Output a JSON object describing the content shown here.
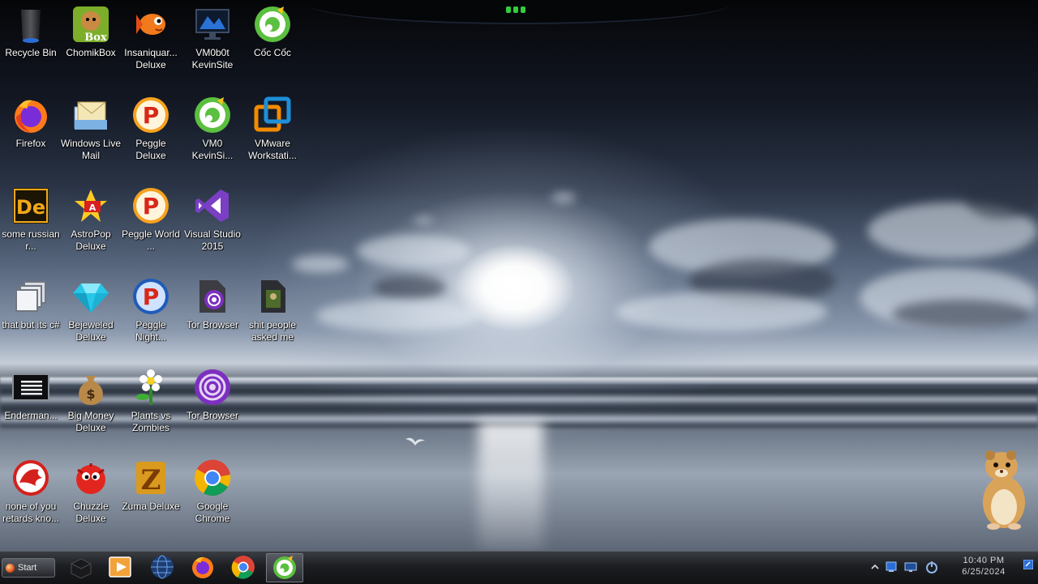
{
  "desktop": {
    "icons": [
      {
        "label": "Recycle Bin",
        "icon": "recycle-bin-icon"
      },
      {
        "label": "ChomikBox",
        "icon": "chomikbox-icon"
      },
      {
        "label": "Insaniquar... Deluxe",
        "icon": "goldfish-icon"
      },
      {
        "label": "VM0b0t KevinSite",
        "icon": "monitor-icon"
      },
      {
        "label": "Cốc Cốc",
        "icon": "coccoc-icon"
      },
      {
        "label": "Firefox",
        "icon": "firefox-icon"
      },
      {
        "label": "Windows Live Mail",
        "icon": "live-mail-icon"
      },
      {
        "label": "Peggle Deluxe",
        "icon": "peggle-icon"
      },
      {
        "label": "VM0 KevinSi...",
        "icon": "coccoc-icon"
      },
      {
        "label": "VMware Workstati...",
        "icon": "vmware-icon"
      },
      {
        "label": "some russian r...",
        "icon": "de-icon"
      },
      {
        "label": "AstroPop Deluxe",
        "icon": "astropop-icon"
      },
      {
        "label": "Peggle World ...",
        "icon": "peggle-icon"
      },
      {
        "label": "Visual Studio 2015",
        "icon": "visual-studio-icon"
      },
      {
        "label": "that but its c#",
        "icon": "windows-stack-icon"
      },
      {
        "label": "Bejeweled Deluxe",
        "icon": "gem-icon"
      },
      {
        "label": "Peggle Night...",
        "icon": "peggle-night-icon"
      },
      {
        "label": "Tor Browser",
        "icon": "tor-folder-icon"
      },
      {
        "label": "shit people asked me",
        "icon": "folder-icon"
      },
      {
        "label": "Enderman...",
        "icon": "console-icon"
      },
      {
        "label": "Big Money Deluxe",
        "icon": "money-bag-icon"
      },
      {
        "label": "Plants vs Zombies",
        "icon": "flower-icon"
      },
      {
        "label": "Tor Browser",
        "icon": "tor-icon"
      },
      {
        "label": "none of you retards kno...",
        "icon": "dragon-icon"
      },
      {
        "label": "Chuzzle Deluxe",
        "icon": "chuzzle-icon"
      },
      {
        "label": "Zuma Deluxe",
        "icon": "zuma-icon"
      },
      {
        "label": "Google Chrome",
        "icon": "chrome-icon"
      }
    ]
  },
  "taskbar": {
    "start_label": "Start",
    "pinned": [
      {
        "icon": "black-box-icon"
      },
      {
        "icon": "media-player-icon"
      },
      {
        "icon": "globe-icon"
      },
      {
        "icon": "firefox-icon"
      },
      {
        "icon": "chrome-icon"
      },
      {
        "icon": "coccoc-icon",
        "active": true
      }
    ],
    "tray": {
      "icons": [
        "chevron-up-icon",
        "network-icon",
        "display-icon",
        "power-icon"
      ],
      "time": "10:40 PM",
      "date": "6/25/2024"
    }
  },
  "colors": {
    "taskbar_top": "#3a3d43",
    "taskbar_bottom": "#111214",
    "label_text": "#ffffff",
    "clock_text": "#cfd3da",
    "coccoc_green": "#5bbf3f",
    "tor_purple": "#7d2fbf"
  }
}
